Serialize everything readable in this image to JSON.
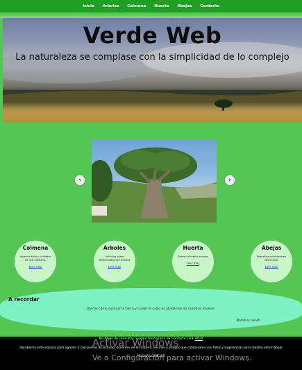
{
  "nav": {
    "items": [
      "Inicio",
      "Arboles",
      "Colmena",
      "Huerta",
      "Abejas",
      "Contacto"
    ]
  },
  "hero": {
    "title": "Verde Web",
    "subtitle": "La naturaleza se complase con la simplicidad de lo complejo"
  },
  "slider": {
    "prev_icon": "chevron-left-icon",
    "next_icon": "chevron-right-icon"
  },
  "cards": [
    {
      "title": "Colmena",
      "desc": "Aprende todo y cuidados de una colmena.",
      "link": "Leer mas"
    },
    {
      "title": "Arboles",
      "desc": "Articulos sobre relacionados con arboles",
      "link": "Leer mas"
    },
    {
      "title": "Huerta",
      "desc": "Datos cultivados a mano",
      "link": "Leer mas"
    },
    {
      "title": "Abejas",
      "desc": "Pequeños polinizadores del mundo",
      "link": "Leer mas"
    }
  ],
  "recordar": {
    "title": "A recordar",
    "quote": "Olvidar cómo excavar la tierra y cuidar el suelo es olvidarnos de nosotros mismos.",
    "author": "Mahatma Gandhi"
  },
  "footer": {
    "line1_prefix": "No dejés de consultar nuestro form ulario de Contacto click ",
    "line1_link": "AQUI",
    "line2": "Aprobecho este espacio para agreser a con padres de estudio, docentes de la materia, vecinos y amigos que colaboraron con fotos y sugerencias para realizar este trabajo",
    "line3": "MUCHAS GRACIAS"
  },
  "watermark": {
    "title": "Activar Windows",
    "subtitle": "Ve a Configuración para activar Windows."
  },
  "colors": {
    "page_bg": "#55c653",
    "nav_bg": "#1fa024",
    "card_bg": "#c9f6c8",
    "recordar_bg": "#7ff2c4",
    "footer_bg": "#000000",
    "link": "#1a33c4"
  }
}
